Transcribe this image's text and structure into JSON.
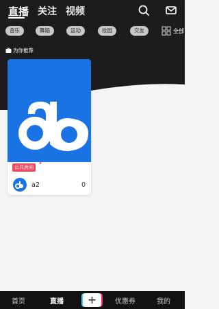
{
  "header": {
    "tabs": [
      {
        "label": "直播",
        "active": true
      },
      {
        "label": "关注",
        "active": false
      },
      {
        "label": "视频",
        "active": false
      }
    ],
    "search_icon": "search-icon",
    "mail_icon": "mail-icon"
  },
  "categories": [
    {
      "label": "音乐"
    },
    {
      "label": "舞蹈"
    },
    {
      "label": "运动"
    },
    {
      "label": "校园"
    },
    {
      "label": "交友"
    }
  ],
  "all_label": "全部",
  "recommend_label": "为你推荐",
  "rooms": [
    {
      "badge": "公共房间",
      "name": "a2",
      "count": "0"
    }
  ],
  "bottom_nav": {
    "home": "首页",
    "live": "直播",
    "plus": "+",
    "coupon": "优惠券",
    "mine": "我的"
  },
  "colors": {
    "accent_blue": "#1a73e3",
    "badge_red": "#f0495c",
    "dark_bg": "#1c1c1f"
  }
}
